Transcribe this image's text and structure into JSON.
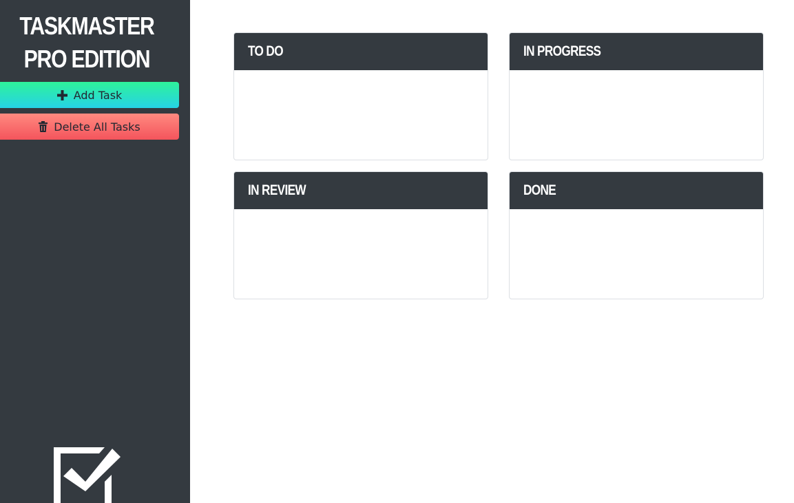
{
  "app": {
    "title": "TASKMASTER PRO EDITION"
  },
  "sidebar": {
    "buttons": {
      "add_task": {
        "label": "Add Task",
        "icon": "plus-icon"
      },
      "delete_all": {
        "label": "Delete All Tasks",
        "icon": "trash-icon"
      }
    },
    "logo_icon": "checkbox-check-icon"
  },
  "board": {
    "columns": [
      {
        "title": "TO DO",
        "tasks": []
      },
      {
        "title": "IN PROGRESS",
        "tasks": []
      },
      {
        "title": "IN REVIEW",
        "tasks": []
      },
      {
        "title": "DONE",
        "tasks": []
      }
    ]
  },
  "colors": {
    "sidebar_bg": "#343a40",
    "column_header_bg": "#343a40",
    "add_button_gradient": [
      "#2ef29a",
      "#26d3e6"
    ],
    "delete_button_gradient": [
      "#ff8a80",
      "#f4545c"
    ]
  }
}
